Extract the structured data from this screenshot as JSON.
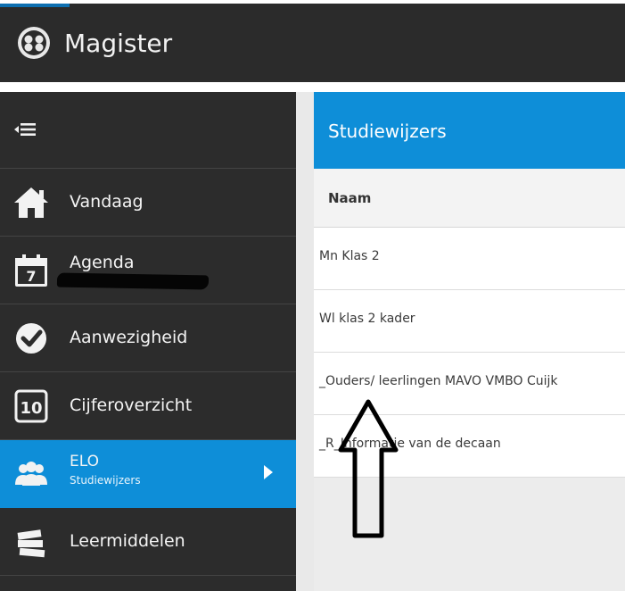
{
  "app": {
    "title": "Magister"
  },
  "sidebar": {
    "items": [
      {
        "label": "Vandaag"
      },
      {
        "label": "Agenda",
        "icon_day": "7"
      },
      {
        "label": "Aanwezigheid"
      },
      {
        "label": "Cijferoverzicht",
        "icon_number": "10"
      },
      {
        "label": "ELO",
        "sublabel": "Studiewijzers"
      },
      {
        "label": "Leermiddelen"
      }
    ]
  },
  "main": {
    "title": "Studiewijzers",
    "column_header": "Naam",
    "rows": [
      {
        "name": "Mn Klas 2"
      },
      {
        "name": "Wl klas 2 kader"
      },
      {
        "name": "_Ouders/ leerlingen MAVO VMBO Cuijk"
      },
      {
        "name": "_R_Informatie van de decaan"
      }
    ]
  },
  "colors": {
    "topbar": "#2b2b2b",
    "sidebar": "#2c2c2c",
    "accent": "#0e8ed8",
    "content_background": "#ececec"
  },
  "icons": [
    "logo-icon",
    "menu-collapse-icon",
    "home-icon",
    "calendar-icon",
    "checkmark-icon",
    "number-badge-icon",
    "group-icon",
    "chevron-right-icon",
    "books-icon"
  ]
}
